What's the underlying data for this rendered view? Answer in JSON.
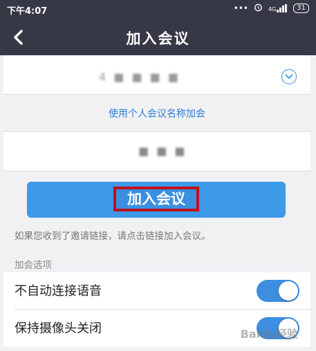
{
  "status_bar": {
    "time": "下午4:07",
    "signal_text": "4G",
    "battery": "31"
  },
  "header": {
    "title": "加入会议"
  },
  "form": {
    "meeting_id_value": "4 ■ ■ ■ ■",
    "switch_link": "使用个人会议名称加会",
    "display_name_value": "■ ■ ■",
    "join_button": "加入会议",
    "hint": "如果您收到了邀请链接，请点击链接加入会议。"
  },
  "options": {
    "section_title": "加会选项",
    "items": [
      {
        "label": "不自动连接语音",
        "on": true
      },
      {
        "label": "保持摄像头关闭",
        "on": true
      }
    ]
  },
  "watermark": "Baidu经验",
  "colors": {
    "header_bg": "#363845",
    "accent": "#3d9ae8",
    "highlight_border": "#c0101a"
  }
}
